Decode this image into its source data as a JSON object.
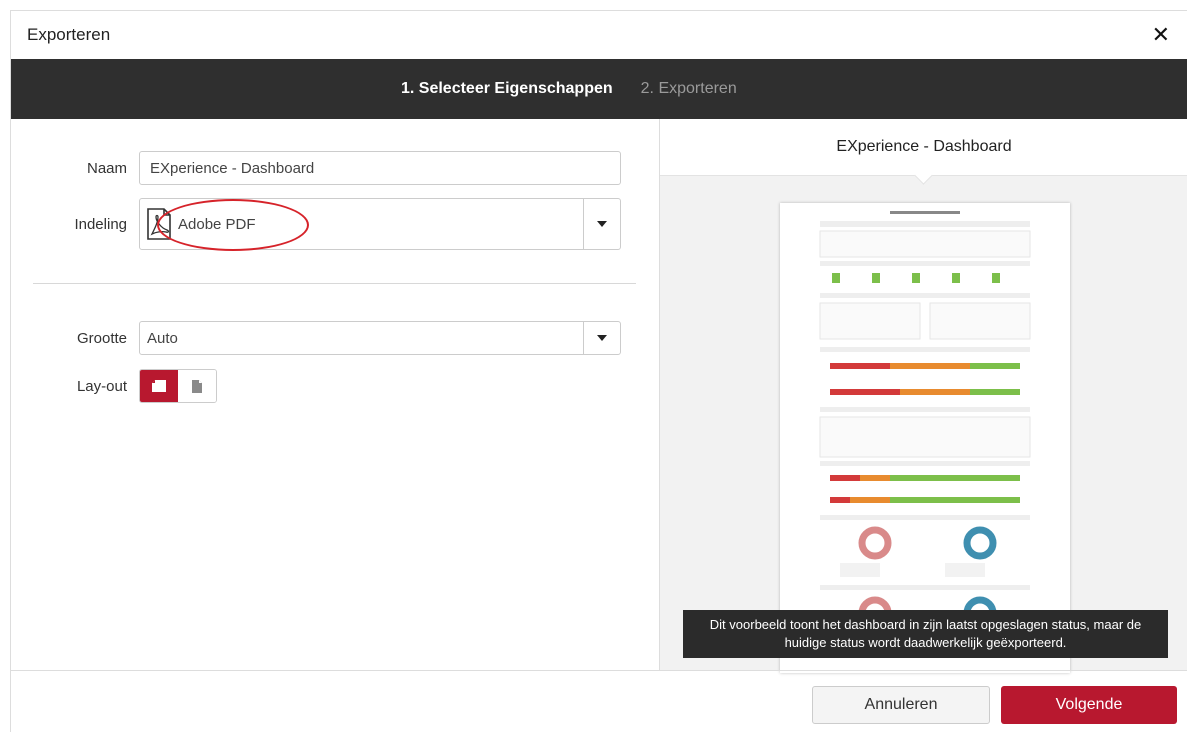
{
  "dialog": {
    "title": "Exporteren",
    "close_icon": "close-icon"
  },
  "steps": [
    {
      "label": "1. Selecteer Eigenschappen",
      "active": true
    },
    {
      "label": "2. Exporteren",
      "active": false
    }
  ],
  "form": {
    "name_label": "Naam",
    "name_value": "EXperience - Dashboard",
    "format_label": "Indeling",
    "format_value": "Adobe PDF",
    "format_icon": "pdf-file-icon",
    "size_label": "Grootte",
    "size_value": "Auto",
    "layout_label": "Lay-out",
    "layout_options": [
      {
        "icon": "landscape-page-icon",
        "selected": true
      },
      {
        "icon": "portrait-page-icon",
        "selected": false
      }
    ]
  },
  "preview": {
    "title": "EXperience - Dashboard",
    "tooltip": "Dit voorbeeld toont het dashboard in zijn laatst opgeslagen status, maar de huidige status wordt daadwerkelijk geëxporteerd."
  },
  "footer": {
    "cancel_label": "Annuleren",
    "next_label": "Volgende"
  },
  "colors": {
    "accent": "#b8182f",
    "stepbar": "#2f2f2f"
  }
}
